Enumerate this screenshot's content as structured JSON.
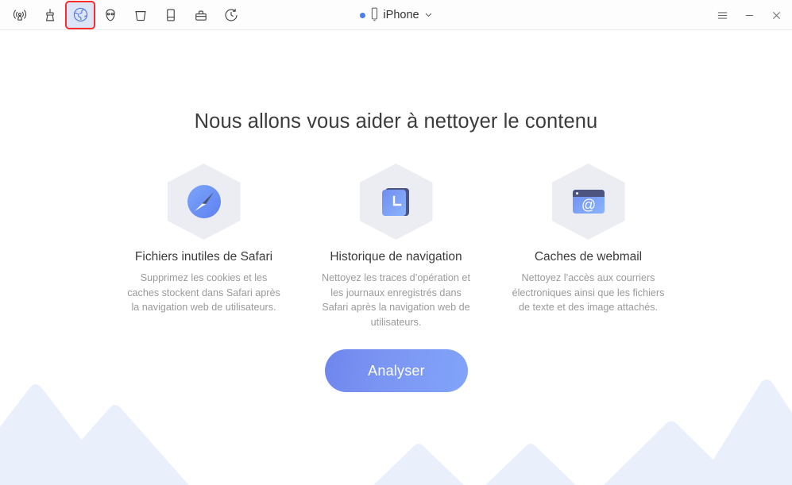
{
  "window": {
    "toolbar_icons": [
      {
        "name": "broadcast-icon",
        "label": "Broadcast"
      },
      {
        "name": "cleaner-brush-icon",
        "label": "Cleaner"
      },
      {
        "name": "globe-icon",
        "label": "Privacy / Browser",
        "selected": true
      },
      {
        "name": "mask-icon",
        "label": "Mask"
      },
      {
        "name": "trash-bucket-icon",
        "label": "Trash"
      },
      {
        "name": "device-icon",
        "label": "Device"
      },
      {
        "name": "toolbox-icon",
        "label": "Toolbox"
      },
      {
        "name": "history-clock-icon",
        "label": "History"
      }
    ],
    "device": {
      "status_color": "#4a7df0",
      "name": "iPhone",
      "chevron": "⌄"
    },
    "controls": {
      "menu": "menu-icon",
      "minimize": "minimize-icon",
      "close": "close-icon"
    }
  },
  "main": {
    "title": "Nous allons vous aider à nettoyer le contenu",
    "features": [
      {
        "icon": "safari-compass-icon",
        "title": "Fichiers inutiles de Safari",
        "desc": "Supprimez les cookies et les caches stockent dans Safari après la navigation web de utilisateurs."
      },
      {
        "icon": "history-card-icon",
        "title": "Historique de navigation",
        "desc": "Nettoyez les traces d’opération et les journaux enregistrés dans Safari après la navigation web de utilisateurs."
      },
      {
        "icon": "webmail-window-icon",
        "title": "Caches de webmail",
        "desc": "Nettoyez l’accès aux courriers électroniques ainsi que les fichiers de texte et des image attachés."
      }
    ],
    "analyse_button": "Analyser"
  },
  "colors": {
    "accent": "#6f86ee",
    "accent_light": "#82a4fa",
    "highlight_box": "#fb2c2c",
    "hex_bg": "#ecedf2",
    "mountain_light": "#eaf0fb",
    "mountain_dark": "#d6e4fa",
    "title_text": "#3c3c3c",
    "desc_text": "#9a9a9a"
  }
}
